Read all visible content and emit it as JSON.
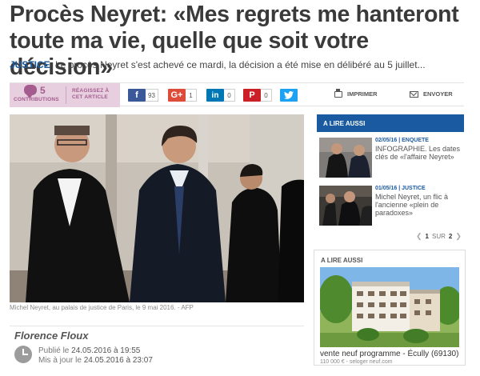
{
  "article": {
    "headline": "Procès Neyret: «Mes regrets me hanteront toute ma vie, quelle que soit votre décision»",
    "rubric": "JUSTICE",
    "chapo": "Le procès Neyret s'est achevé ce mardi, la décision a été mise en délibéré au 5 juillet...",
    "caption": "Michel Neyret, au palais de justice de Paris, le 9 mai 2016. - AFP",
    "author": "Florence Floux",
    "published_label": "Publié le",
    "published_date": "24.05.2016 à 19:55",
    "updated_label": "Mis à jour le",
    "updated_date": "24.05.2016 à 23:07"
  },
  "share": {
    "contrib_count": "5",
    "contrib_label": "CONTRIBUTIONS",
    "react_label": "RÉAGISSEZ À CET ARTICLE",
    "facebook_count": "93",
    "google_count": "1",
    "linkedin_count": "0",
    "pinterest_count": "0",
    "print_label": "IMPRIMER",
    "send_label": "ENVOYER",
    "icons": [
      "facebook-icon",
      "google-plus-icon",
      "linkedin-icon",
      "pinterest-icon",
      "twitter-icon",
      "printer-icon",
      "envelope-icon",
      "comment-icon"
    ]
  },
  "aside": {
    "heading": "A LIRE AUSSI",
    "items": [
      {
        "date": "02/05/16",
        "tag": "ENQUETE",
        "title": "INFOGRAPHIE. Les dates clés de «l'affaire Neyret»"
      },
      {
        "date": "01/05/16",
        "tag": "JUSTICE",
        "title": "Michel Neyret, un flic à l'ancienne «plein de paradoxes»"
      }
    ],
    "pager": {
      "current": "1",
      "sep": "SUR",
      "total": "2"
    }
  },
  "ad": {
    "label": "A LIRE AUSSI",
    "title": "vente neuf programme - Écully (69130)",
    "sub": "110 000 € - seloger neuf.com"
  },
  "colors": {
    "accent_blue": "#1a5aa0",
    "contrib_pink": "#e7cfe0",
    "contrib_purple": "#a45b8e"
  }
}
